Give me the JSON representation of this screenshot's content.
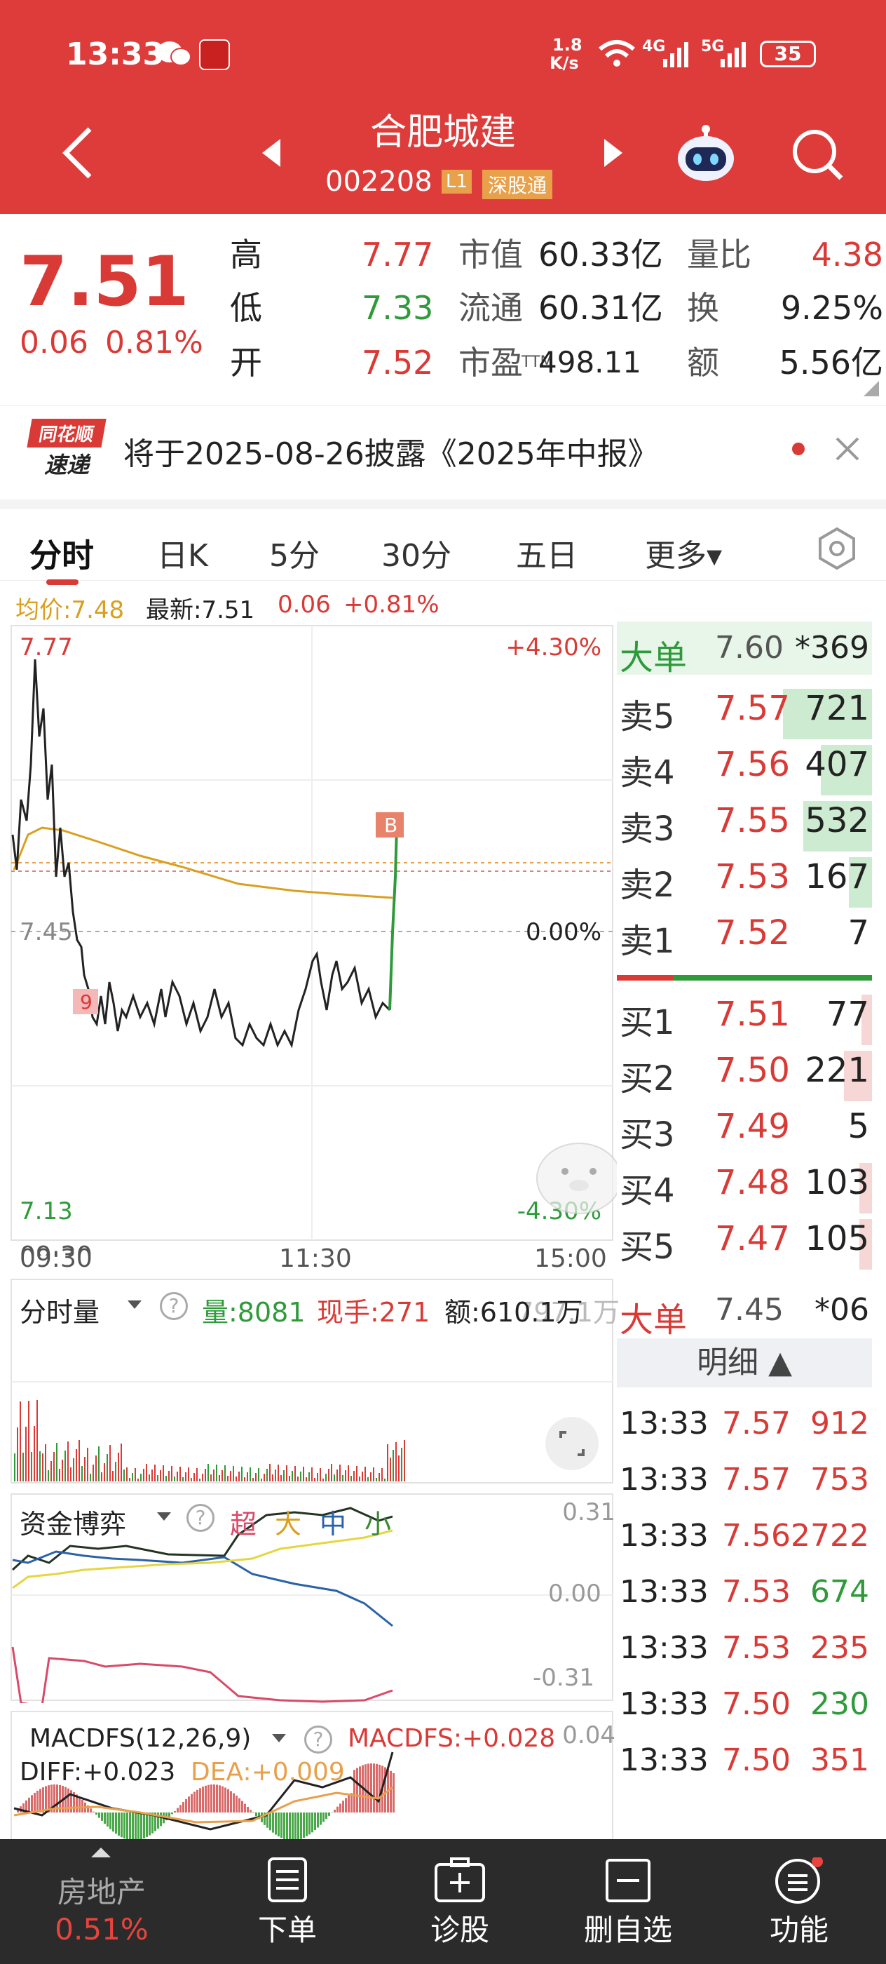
{
  "status": {
    "time": "13:33",
    "net_speed_top": "1.8",
    "net_speed_bot": "K/s",
    "sig4g": "4G",
    "sig5g": "5G",
    "battery": "35"
  },
  "header": {
    "name": "合肥城建",
    "code": "002208",
    "level": "L1",
    "tag": "深股通"
  },
  "quote": {
    "price": "7.51",
    "change": "0.06",
    "pct": "0.81%",
    "high_label": "高",
    "high": "7.77",
    "low_label": "低",
    "low": "7.33",
    "open_label": "开",
    "open": "7.52",
    "mcap_label": "市值",
    "mcap": "60.33亿",
    "float_label": "流通",
    "float": "60.31亿",
    "pe_label": "市盈",
    "pe_sup": "TTM",
    "pe": "498.11",
    "vr_label": "量比",
    "vr": "4.38",
    "turn_label": "换",
    "turn": "9.25%",
    "amt_label": "额",
    "amt": "5.56亿"
  },
  "notice": {
    "logo_top": "同花顺",
    "logo_bot": "速递",
    "text": "将于2025-08-26披露《2025年中报》"
  },
  "tabs": [
    "分时",
    "日K",
    "5分",
    "30分",
    "五日",
    "更多▾"
  ],
  "info": {
    "avg": "均价:7.48",
    "last": "最新:7.51",
    "chg": "0.06",
    "pct": "+0.81%"
  },
  "chart_labels": {
    "ymax": "7.77",
    "ymin": "7.13",
    "ymid": "7.45",
    "pmax": "+4.30%",
    "pmid": "0.00%",
    "pmin": "-4.30%",
    "t0": "09:30",
    "t1": "11:30",
    "t2": "15:00",
    "marker_b": "B",
    "marker_s": "9"
  },
  "orderbook": {
    "big_top": {
      "label": "大单",
      "price": "7.60",
      "vol": "*369"
    },
    "asks": [
      {
        "label": "卖5",
        "price": "7.57",
        "vol": "721",
        "fill": 0.35
      },
      {
        "label": "卖4",
        "price": "7.56",
        "vol": "407",
        "fill": 0.2
      },
      {
        "label": "卖3",
        "price": "7.55",
        "vol": "532",
        "fill": 0.27
      },
      {
        "label": "卖2",
        "price": "7.53",
        "vol": "167",
        "fill": 0.09
      },
      {
        "label": "卖1",
        "price": "7.52",
        "vol": "7",
        "fill": 0
      }
    ],
    "bids": [
      {
        "label": "买1",
        "price": "7.51",
        "vol": "77",
        "fill": 0.04
      },
      {
        "label": "买2",
        "price": "7.50",
        "vol": "221",
        "fill": 0.11
      },
      {
        "label": "买3",
        "price": "7.49",
        "vol": "5",
        "fill": 0
      },
      {
        "label": "买4",
        "price": "7.48",
        "vol": "103",
        "fill": 0.05
      },
      {
        "label": "买5",
        "price": "7.47",
        "vol": "105",
        "fill": 0.05
      }
    ],
    "big_bot": {
      "label": "大单",
      "price": "7.45",
      "vol": "*06"
    }
  },
  "detail": {
    "title": "明细 ▲",
    "rows": [
      {
        "time": "13:33",
        "price": "7.57",
        "vol": "912",
        "c": "#d93a36"
      },
      {
        "time": "13:33",
        "price": "7.57",
        "vol": "753",
        "c": "#d93a36"
      },
      {
        "time": "13:33",
        "price": "7.56",
        "vol": "2722",
        "c": "#d93a36"
      },
      {
        "time": "13:33",
        "price": "7.53",
        "vol": "674",
        "c": "#2e9a3a"
      },
      {
        "time": "13:33",
        "price": "7.53",
        "vol": "235",
        "c": "#d93a36"
      },
      {
        "time": "13:33",
        "price": "7.50",
        "vol": "230",
        "c": "#2e9a3a"
      },
      {
        "time": "13:33",
        "price": "7.50",
        "vol": "351",
        "c": "#d93a36"
      }
    ]
  },
  "vol_panel": {
    "sel": "分时量",
    "vol": "量:8081",
    "now": "现手:271",
    "amt": "额:610.1万",
    "max": "797.1万"
  },
  "fund_panel": {
    "sel": "资金博弈",
    "a": "超",
    "b": "大",
    "c": "中",
    "d": "小",
    "top": "0.31",
    "mid": "0.00",
    "bot": "-0.31"
  },
  "macd_panel": {
    "sel": "MACDFS(12,26,9)",
    "macd": "MACDFS:+0.028",
    "diff": "DIFF:+0.023",
    "dea": "DEA:+0.009",
    "top": "0.04"
  },
  "bottom": {
    "sector": "房地产",
    "sector_pct": "0.51%",
    "n1": "下单",
    "n2": "诊股",
    "n3": "删自选",
    "n4": "功能"
  }
}
